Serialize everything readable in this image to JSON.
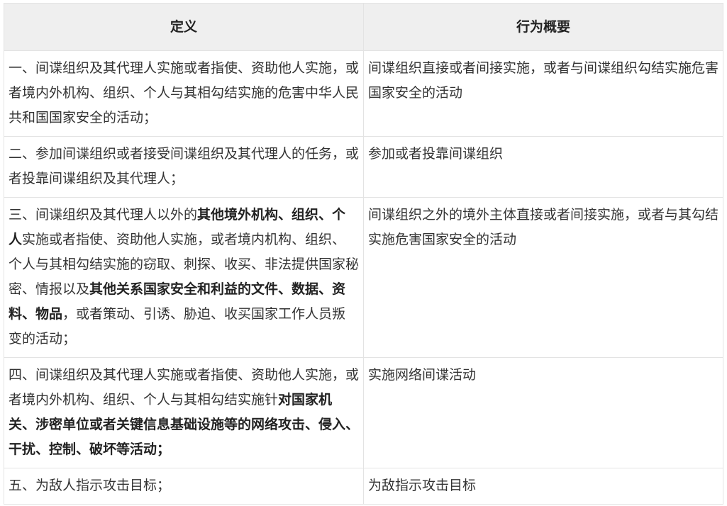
{
  "table": {
    "headers": [
      "定义",
      "行为概要"
    ],
    "rows": [
      {
        "definition": [
          {
            "text": "一、间谍组织及其代理人实施或者指使、资助他人实施，或者境内外机构、组织、个人与其相勾结实施的危害中华人民共和国国家安全的活动；",
            "bold": false
          }
        ],
        "summary": "间谍组织直接或者间接实施，或者与间谍组织勾结实施危害国家安全的活动"
      },
      {
        "definition": [
          {
            "text": "二、参加间谍组织或者接受间谍组织及其代理人的任务，或者投靠间谍组织及其代理人；",
            "bold": false
          }
        ],
        "summary": "参加或者投靠间谍组织"
      },
      {
        "definition": [
          {
            "text": "三、间谍组织及其代理人以外的",
            "bold": false
          },
          {
            "text": "其他境外机构、组织、个人",
            "bold": true
          },
          {
            "text": "实施或者指使、资助他人实施，或者境内机构、组织、个人与其相勾结实施的窃取、刺探、收买、非法提供国家秘密、情报以及",
            "bold": false
          },
          {
            "text": "其他关系国家安全和利益的文件、数据、资料、物品",
            "bold": true
          },
          {
            "text": "，或者策动、引诱、胁迫、收买国家工作人员叛变的活动；",
            "bold": false
          }
        ],
        "summary": "间谍组织之外的境外主体直接或者间接实施，或者与其勾结实施危害国家安全的活动"
      },
      {
        "definition": [
          {
            "text": "四、间谍组织及其代理人实施或者指使、资助他人实施，或者境内外机构、组织、个人与其相勾结实施针",
            "bold": false
          },
          {
            "text": "对国家机关、涉密单位或者关键信息基础设施等的网络攻击、侵入、干扰、控制、破坏等活动；",
            "bold": true
          }
        ],
        "summary": "实施网络间谍活动"
      },
      {
        "definition": [
          {
            "text": "五、为敌人指示攻击目标；",
            "bold": false
          }
        ],
        "summary": "为敌指示攻击目标"
      }
    ]
  }
}
